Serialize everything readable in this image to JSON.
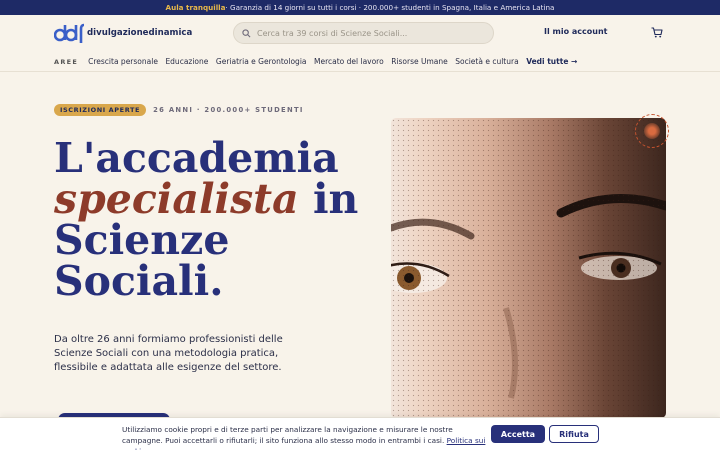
{
  "topbar": {
    "highlight": "Aula tranquilla",
    "text": " · Garanzia di 14 giorni su tutti i corsi · 200.000+ studenti in Spagna, Italia e America Latina"
  },
  "header": {
    "logo_text": "divulgazionedinamica",
    "search_placeholder": "Cerca tra 39 corsi di Scienze Sociali...",
    "account_label": "Il mio account",
    "icons": [
      "logo-mark",
      "search-icon",
      "cart-icon"
    ]
  },
  "nav": {
    "label": "AREE",
    "items": [
      "Crescita personale",
      "Educazione",
      "Geriatria e Gerontologia",
      "Mercato del lavoro",
      "Risorse Umane",
      "Società e cultura"
    ],
    "see_all": "Vedi tutte →"
  },
  "hero": {
    "badge": "ISCRIZIONI APERTE",
    "meta": "26 ANNI · 200.000+ STUDENTI",
    "headline_1": "L'accademia",
    "headline_em": "specialista",
    "headline_2": " in",
    "headline_3": "Scienze",
    "headline_4": "Sociali.",
    "lead": "Da oltre 26 anni formiamo professionisti delle Scienze Sociali con una metodologia pratica, flessibile e adattata alle esigenze del settore."
  },
  "cookie": {
    "text": "Utilizziamo cookie propri e di terze parti per analizzare la navigazione e misurare le nostre campagne. Puoi accettarli o rifiutarli; il sito funziona allo stesso modo in entrambi i casi. ",
    "link": "Politica sui cookie",
    "accept": "Accetta",
    "reject": "Rifiuta"
  },
  "colors": {
    "brand_navy": "#28307a",
    "accent_gold": "#d9a74c",
    "accent_rust": "#8d3b2a",
    "background": "#f8f3ea"
  }
}
